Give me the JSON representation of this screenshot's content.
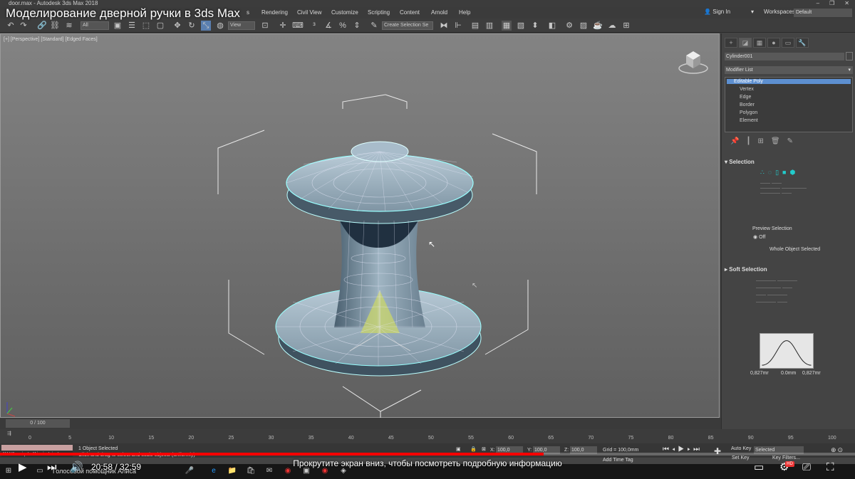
{
  "window": {
    "app_title": "door.max - Autodesk 3ds Max 2018",
    "video_title": "Моделирование дверной ручки в 3ds Max"
  },
  "menu": [
    "Rendering",
    "Civil View",
    "Customize",
    "Scripting",
    "Content",
    "Arnold",
    "Help"
  ],
  "menu_partial": "s",
  "account": {
    "signin": "Sign In",
    "workspaces_label": "Workspaces:",
    "workspace_value": "Default"
  },
  "toolbar": {
    "filter_value": "All",
    "view_value": "View",
    "selection_set_placeholder": "Create Selection Se"
  },
  "viewport": {
    "label": "[+] [Perspective] [Standard] [Edged Faces]"
  },
  "command_panel": {
    "object_name": "Cylinder001",
    "modifier_list": "Modifier List",
    "stack": [
      "Editable Poly",
      "Vertex",
      "Edge",
      "Border",
      "Polygon",
      "Element"
    ],
    "selection_title": "Selection",
    "preview_selection_label": "Preview Selection",
    "preview_off": "Off",
    "whole_object_selected": "Whole Object Selected",
    "soft_selection_title": "Soft Selection",
    "curve_left": "0,827mr",
    "curve_mid": "0.0mm",
    "curve_right": "0,827mr"
  },
  "timeline": {
    "slider_label": "0 / 100",
    "ticks": [
      "0",
      "5",
      "10",
      "15",
      "20",
      "25",
      "30",
      "35",
      "40",
      "45",
      "50",
      "55",
      "60",
      "65",
      "70",
      "75",
      "80",
      "85",
      "90",
      "95",
      "100"
    ]
  },
  "status": {
    "maxscript": "MAXScript Mini Listene",
    "objects_selected": "1 Object Selected",
    "prompt": "Click and drag to select and scale objects (uniformly)",
    "x_label": "X:",
    "x_value": "100,0",
    "y_label": "Y:",
    "y_value": "100,0",
    "z_label": "Z:",
    "z_value": "100,0",
    "grid": "Grid = 100,0mm",
    "add_time_tag": "Add Time Tag",
    "auto_key": "Auto Key",
    "set_key": "Set Key",
    "selected": "Selected",
    "key_filters": "Key Filters..."
  },
  "taskbar": {
    "search_hint": "Голосовой помощник Алиса"
  },
  "video": {
    "current_time": "20:58",
    "duration": "32:59",
    "time_display": "20:58 / 32:59",
    "progress_fraction": 0.636,
    "notice": "Прокрутите экран вниз, чтобы посмотреть подробную информацию",
    "hd_badge": "HD"
  }
}
